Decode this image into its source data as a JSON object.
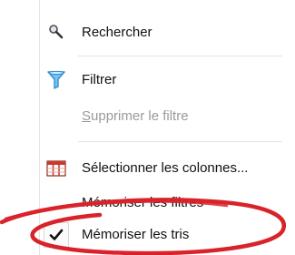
{
  "menu": {
    "items": [
      {
        "label": "Rechercher",
        "icon": "search-icon",
        "enabled": true,
        "checked": false
      },
      {
        "label": "Filtrer",
        "icon": "filter-funnel-icon",
        "enabled": true,
        "checked": false
      },
      {
        "label": "Supprimer le filtre",
        "icon": "",
        "enabled": false,
        "checked": false
      },
      {
        "label": "Sélectionner les colonnes...",
        "icon": "columns-icon",
        "enabled": true,
        "checked": false
      },
      {
        "label": "Mémoriser les filtres",
        "icon": "",
        "enabled": true,
        "checked": false
      },
      {
        "label": "Mémoriser les tris",
        "icon": "checkmark-icon",
        "enabled": true,
        "checked": true
      }
    ]
  },
  "colors": {
    "menu_background": "#ffffff",
    "text": "#111111",
    "disabled_text": "#9a9a9a",
    "annotation_ink": "#d9232a",
    "funnel": "#2f8fd8",
    "columns_icon_red": "#c83a2a"
  }
}
